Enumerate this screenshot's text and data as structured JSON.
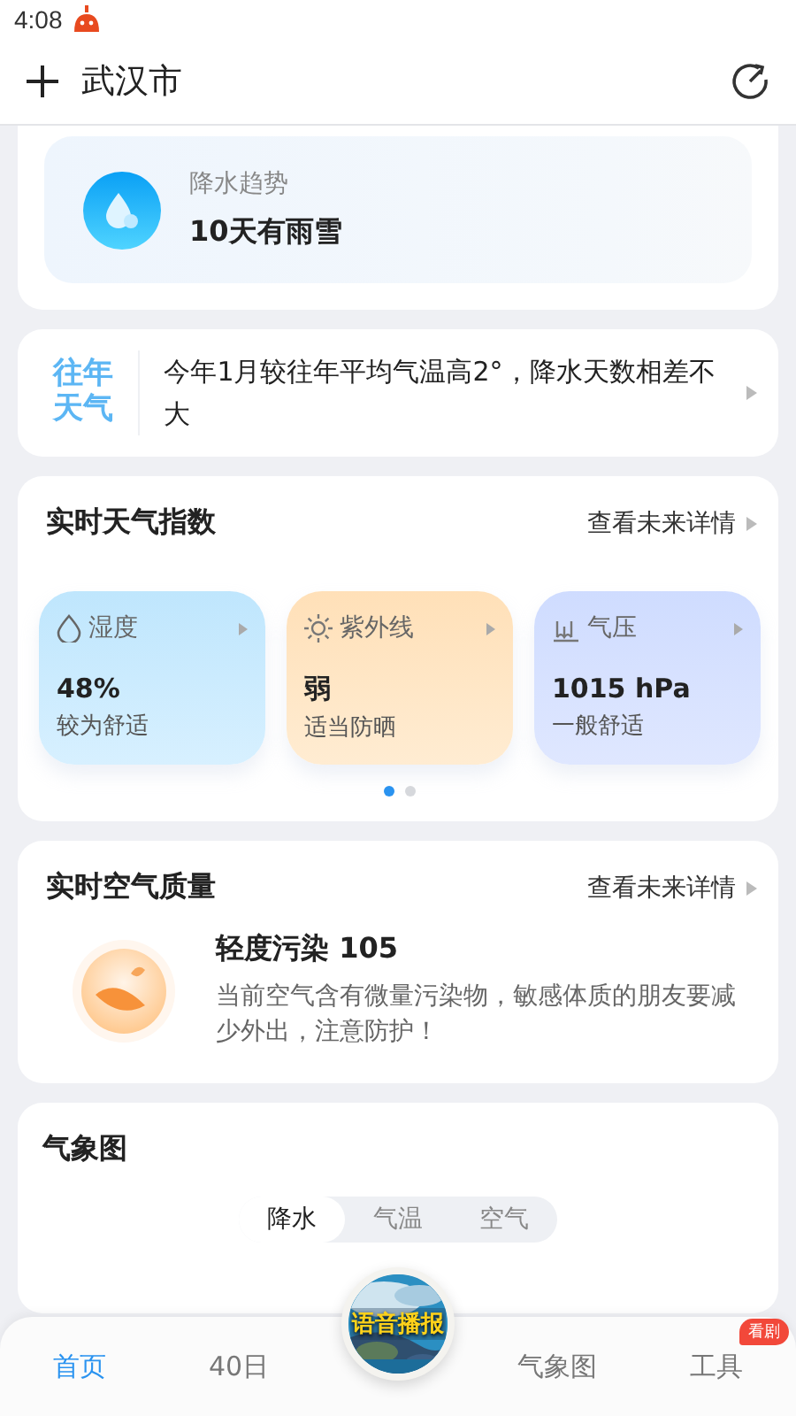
{
  "status_bar": {
    "time": "4:08"
  },
  "header": {
    "city": "武汉市"
  },
  "precip_card": {
    "label": "降水趋势",
    "value": "10天有雨雪"
  },
  "history_card": {
    "badge": "往年天气",
    "text": "今年1月较往年平均气温高2°，降水天数相差不大"
  },
  "index_section": {
    "title": "实时天气指数",
    "link": "查看未来详情",
    "tiles": [
      {
        "kind": "humidity",
        "label": "湿度",
        "value": "48%",
        "desc": "较为舒适"
      },
      {
        "kind": "uv",
        "label": "紫外线",
        "value": "弱",
        "desc": "适当防晒"
      },
      {
        "kind": "pressure",
        "label": "气压",
        "value": "1015 hPa",
        "desc": "一般舒适"
      }
    ],
    "pages": [
      {
        "selected": true
      },
      {
        "selected": false
      }
    ]
  },
  "air_section": {
    "title": "实时空气质量",
    "link": "查看未来详情",
    "level": "轻度污染 105",
    "desc": "当前空气含有微量污染物，敏感体质的朋友要减少外出，注意防护！"
  },
  "map_section": {
    "title": "气象图",
    "segments": [
      {
        "label": "降水",
        "selected": true
      },
      {
        "label": "气温",
        "selected": false
      },
      {
        "label": "空气",
        "selected": false
      }
    ]
  },
  "voice_button": {
    "label": "语音播报"
  },
  "bottom_nav": [
    {
      "label": "首页",
      "selected": true
    },
    {
      "label": "40日",
      "selected": false
    },
    {
      "label": "气象图",
      "selected": false
    },
    {
      "label": "工具",
      "selected": false,
      "badge": "看剧"
    }
  ]
}
